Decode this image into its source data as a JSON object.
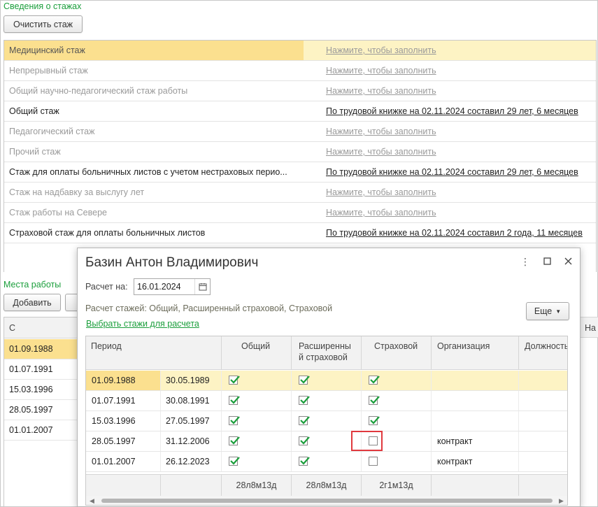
{
  "top": {
    "title": "Сведения о стажах",
    "clear_button": "Очистить стаж"
  },
  "stazh_rows": [
    {
      "name": "Медицинский стаж",
      "value": "Нажмите, чтобы заполнить"
    },
    {
      "name": "Непрерывный стаж",
      "value": "Нажмите, чтобы заполнить"
    },
    {
      "name": "Общий научно-педагогический стаж работы",
      "value": "Нажмите, чтобы заполнить"
    },
    {
      "name": "Общий стаж",
      "value": "По трудовой книжке на 02.11.2024 составил 29 лет, 6 месяцев"
    },
    {
      "name": "Педагогический стаж",
      "value": "Нажмите, чтобы заполнить"
    },
    {
      "name": "Прочий стаж",
      "value": "Нажмите, чтобы заполнить"
    },
    {
      "name": "Стаж для оплаты больничных листов с учетом нестраховых перио...",
      "value": "По трудовой книжке на 02.11.2024 составил 29 лет, 6 месяцев"
    },
    {
      "name": "Стаж на надбавку за выслугу лет",
      "value": "Нажмите, чтобы заполнить"
    },
    {
      "name": "Стаж работы на Севере",
      "value": "Нажмите, чтобы заполнить"
    },
    {
      "name": "Страховой стаж для оплаты больничных листов",
      "value": "По трудовой книжке на 02.11.2024 составил 2 года, 11 месяцев"
    }
  ],
  "mesta": {
    "title": "Места работы",
    "add_button": "Добавить",
    "col_header": "С",
    "right_header": "На",
    "dates": [
      "01.09.1988",
      "01.07.1991",
      "15.03.1996",
      "28.05.1997",
      "01.01.2007"
    ]
  },
  "dialog": {
    "title": "Базин Антон Владимирович",
    "raschet_label": "Расчет на:",
    "raschet_date": "16.01.2024",
    "raschet_info": "Расчет стажей: Общий, Расширенный страховой, Страховой",
    "choose_link": "Выбрать стажи для расчета",
    "more_button": "Еще",
    "columns": {
      "period": "Период",
      "obshiy": "Общий",
      "rasshiren_1": "Расширенны",
      "rasshiren_2": "й страховой",
      "strahovoy": "Страховой",
      "org": "Организация",
      "dolzh": "Должность"
    },
    "rows": [
      {
        "from": "01.09.1988",
        "to": "30.05.1989",
        "obshiy": true,
        "rassh": true,
        "strah": true,
        "org": ""
      },
      {
        "from": "01.07.1991",
        "to": "30.08.1991",
        "obshiy": true,
        "rassh": true,
        "strah": true,
        "org": ""
      },
      {
        "from": "15.03.1996",
        "to": "27.05.1997",
        "obshiy": true,
        "rassh": true,
        "strah": true,
        "org": ""
      },
      {
        "from": "28.05.1997",
        "to": "31.12.2006",
        "obshiy": true,
        "rassh": true,
        "strah": false,
        "org": "контракт"
      },
      {
        "from": "01.01.2007",
        "to": "26.12.2023",
        "obshiy": true,
        "rassh": true,
        "strah": false,
        "org": "контракт"
      }
    ],
    "totals": {
      "obshiy": "28л8м13д",
      "rassh": "28л8м13д",
      "strah": "2г1м13д"
    }
  },
  "colors": {
    "accent_green": "#1a9e3b",
    "selection_yellow": "#fbe08f",
    "highlight_red": "#e0393e"
  }
}
